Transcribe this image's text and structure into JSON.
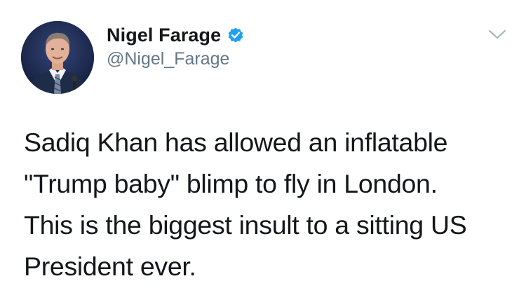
{
  "tweet": {
    "author": {
      "display_name": "Nigel Farage",
      "handle": "@Nigel_Farage",
      "verified": true,
      "avatar_icon": "profile-photo"
    },
    "menu_icon": "chevron-down-icon",
    "text_lines": [
      "Sadiq Khan has allowed an inflatable",
      "\"Trump baby\" blimp to fly in London.",
      "This is the biggest insult to a sitting US",
      "President ever."
    ]
  },
  "colors": {
    "verified_badge": "#1da1f2",
    "handle": "#657786",
    "text": "#14171a",
    "chevron": "#aab8c2"
  }
}
